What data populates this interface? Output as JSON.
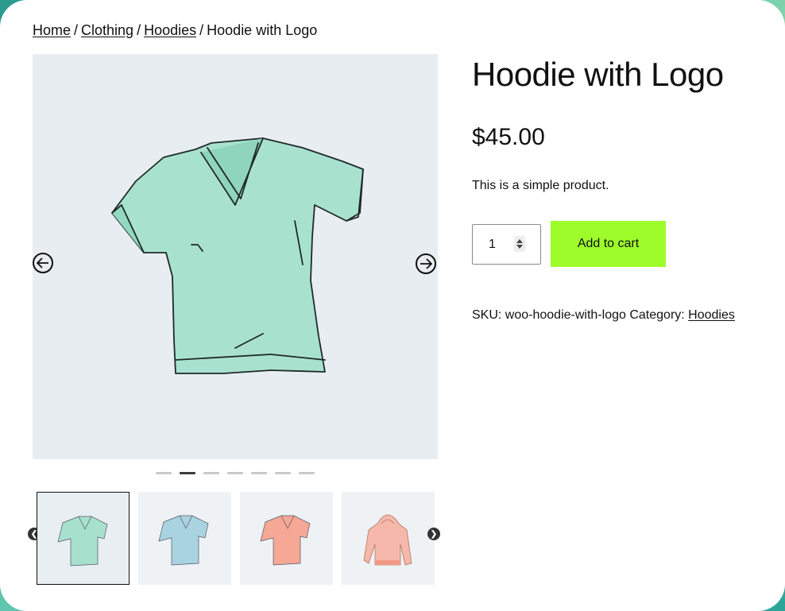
{
  "breadcrumb": {
    "items": [
      {
        "label": "Home",
        "link": true
      },
      {
        "label": "Clothing",
        "link": true
      },
      {
        "label": "Hoodies",
        "link": true
      },
      {
        "label": "Hoodie with Logo",
        "link": false
      }
    ],
    "separator": "/"
  },
  "product": {
    "title": "Hoodie with Logo",
    "price": "$45.00",
    "description": "This is a simple product.",
    "quantity": "1",
    "add_to_cart_label": "Add to cart",
    "sku_label": "SKU:",
    "sku": "woo-hoodie-with-logo",
    "category_label": "Category:",
    "category": "Hoodies"
  },
  "gallery": {
    "prev_icon": "arrow-left-circle-icon",
    "next_icon": "arrow-right-circle-icon",
    "slide_count": 7,
    "active_slide": 2,
    "main_image": "green-vneck-tshirt",
    "thumbnails": [
      {
        "image": "green-vneck-tshirt",
        "color": "#a7e0cc",
        "selected": true,
        "kind": "tshirt"
      },
      {
        "image": "blue-vneck-tshirt",
        "color": "#a9d3e0",
        "selected": false,
        "kind": "tshirt"
      },
      {
        "image": "salmon-vneck-tshirt",
        "color": "#f5a895",
        "selected": false,
        "kind": "tshirt"
      },
      {
        "image": "pink-hoodie",
        "color": "#f6b8ab",
        "selected": false,
        "kind": "hoodie"
      }
    ]
  },
  "colors": {
    "accent_button": "#9efc2b",
    "shirt_main": "#a8e2cf",
    "gallery_bg": "#e8edf1"
  }
}
